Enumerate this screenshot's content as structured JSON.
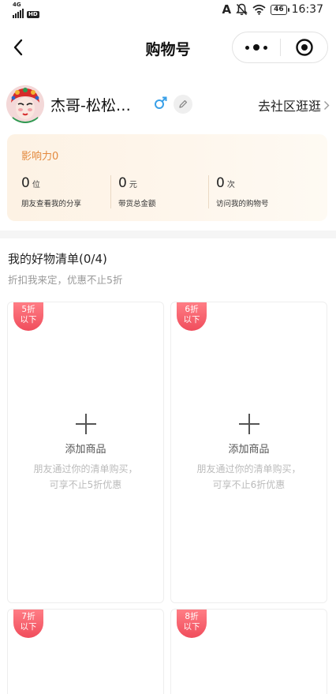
{
  "status_bar": {
    "network": "4G",
    "hd": "HD",
    "battery": "46",
    "time": "16:37"
  },
  "nav": {
    "title": "购物号",
    "back_icon": "chevron-left-icon",
    "more_icon": "more-dots-icon",
    "close_icon": "target-circle-icon"
  },
  "profile": {
    "name": "杰哥-松松…",
    "gender_icon": "male-icon",
    "edit_icon": "pencil-icon",
    "community_link": "去社区逛逛"
  },
  "influence": {
    "title": "影响力0",
    "stats": [
      {
        "value": "0",
        "unit": "位",
        "label": "朋友查看我的分享"
      },
      {
        "value": "0",
        "unit": "元",
        "label": "带货总金额"
      },
      {
        "value": "0",
        "unit": "次",
        "label": "访问我的购物号"
      }
    ]
  },
  "wishlist": {
    "title": "我的好物清单(0/4)",
    "subtitle": "折扣我来定，优惠不止5折",
    "cards": [
      {
        "tag_line1": "5折",
        "tag_line2": "以下",
        "add_label": "添加商品",
        "desc_line1": "朋友通过你的清单购买，",
        "desc_line2": "可享不止5折优惠"
      },
      {
        "tag_line1": "6折",
        "tag_line2": "以下",
        "add_label": "添加商品",
        "desc_line1": "朋友通过你的清单购买，",
        "desc_line2": "可享不止6折优惠"
      },
      {
        "tag_line1": "7折",
        "tag_line2": "以下"
      },
      {
        "tag_line1": "8折",
        "tag_line2": "以下"
      }
    ]
  },
  "colors": {
    "accent_orange": "#e3893e",
    "tag_red": "#f04d5c",
    "male_blue": "#3aa0e8"
  }
}
